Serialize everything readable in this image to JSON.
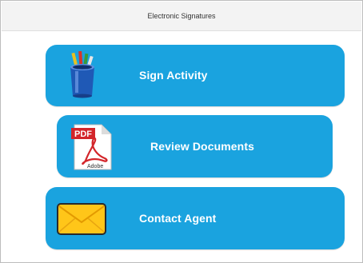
{
  "header": {
    "title": "Electronic Signatures"
  },
  "buttons": [
    {
      "label": "Sign Activity",
      "icon": "pencil-cup-icon"
    },
    {
      "label": "Review Documents",
      "icon": "pdf-document-icon",
      "icon_text_top": "PDF",
      "icon_text_bottom": "Adobe"
    },
    {
      "label": "Contact Agent",
      "icon": "envelope-icon"
    }
  ],
  "colors": {
    "button": "#1aa3df",
    "header_bg": "#f3f3f3",
    "pdf_red": "#d3252a",
    "envelope_yellow": "#ffc619"
  }
}
